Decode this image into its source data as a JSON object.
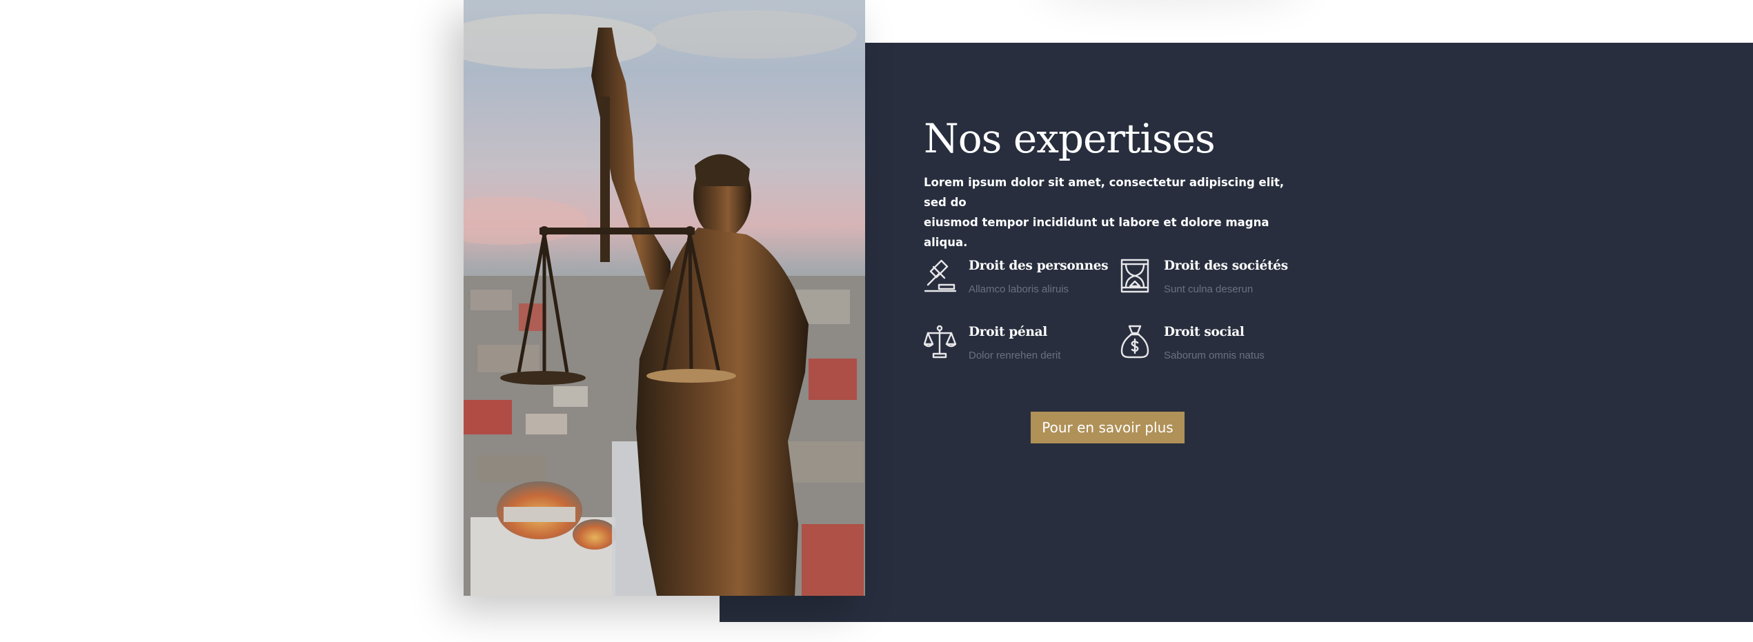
{
  "section": {
    "title": "Nos expertises",
    "intro_line1": "Lorem ipsum dolor sit amet, consectetur adipiscing elit, sed do",
    "intro_line2": "eiusmod tempor incididunt ut labore et dolore magna aliqua.",
    "cta_label": "Pour en savoir plus"
  },
  "expertises": [
    {
      "name": "Droit des personnes",
      "desc": "Allamco laboris aliruis",
      "icon": "gavel-icon"
    },
    {
      "name": "Droit des sociétés",
      "desc": "Sunt culna deserun",
      "icon": "hourglass-icon"
    },
    {
      "name": "Droit pénal",
      "desc": "Dolor renrehen derit",
      "icon": "scales-icon"
    },
    {
      "name": "Droit social",
      "desc": "Saborum omnis natus",
      "icon": "money-bag-icon"
    }
  ],
  "colors": {
    "panel_bg": "#282e3e",
    "accent": "#b09158",
    "muted_text": "#6c7181",
    "text": "#ffffff"
  }
}
